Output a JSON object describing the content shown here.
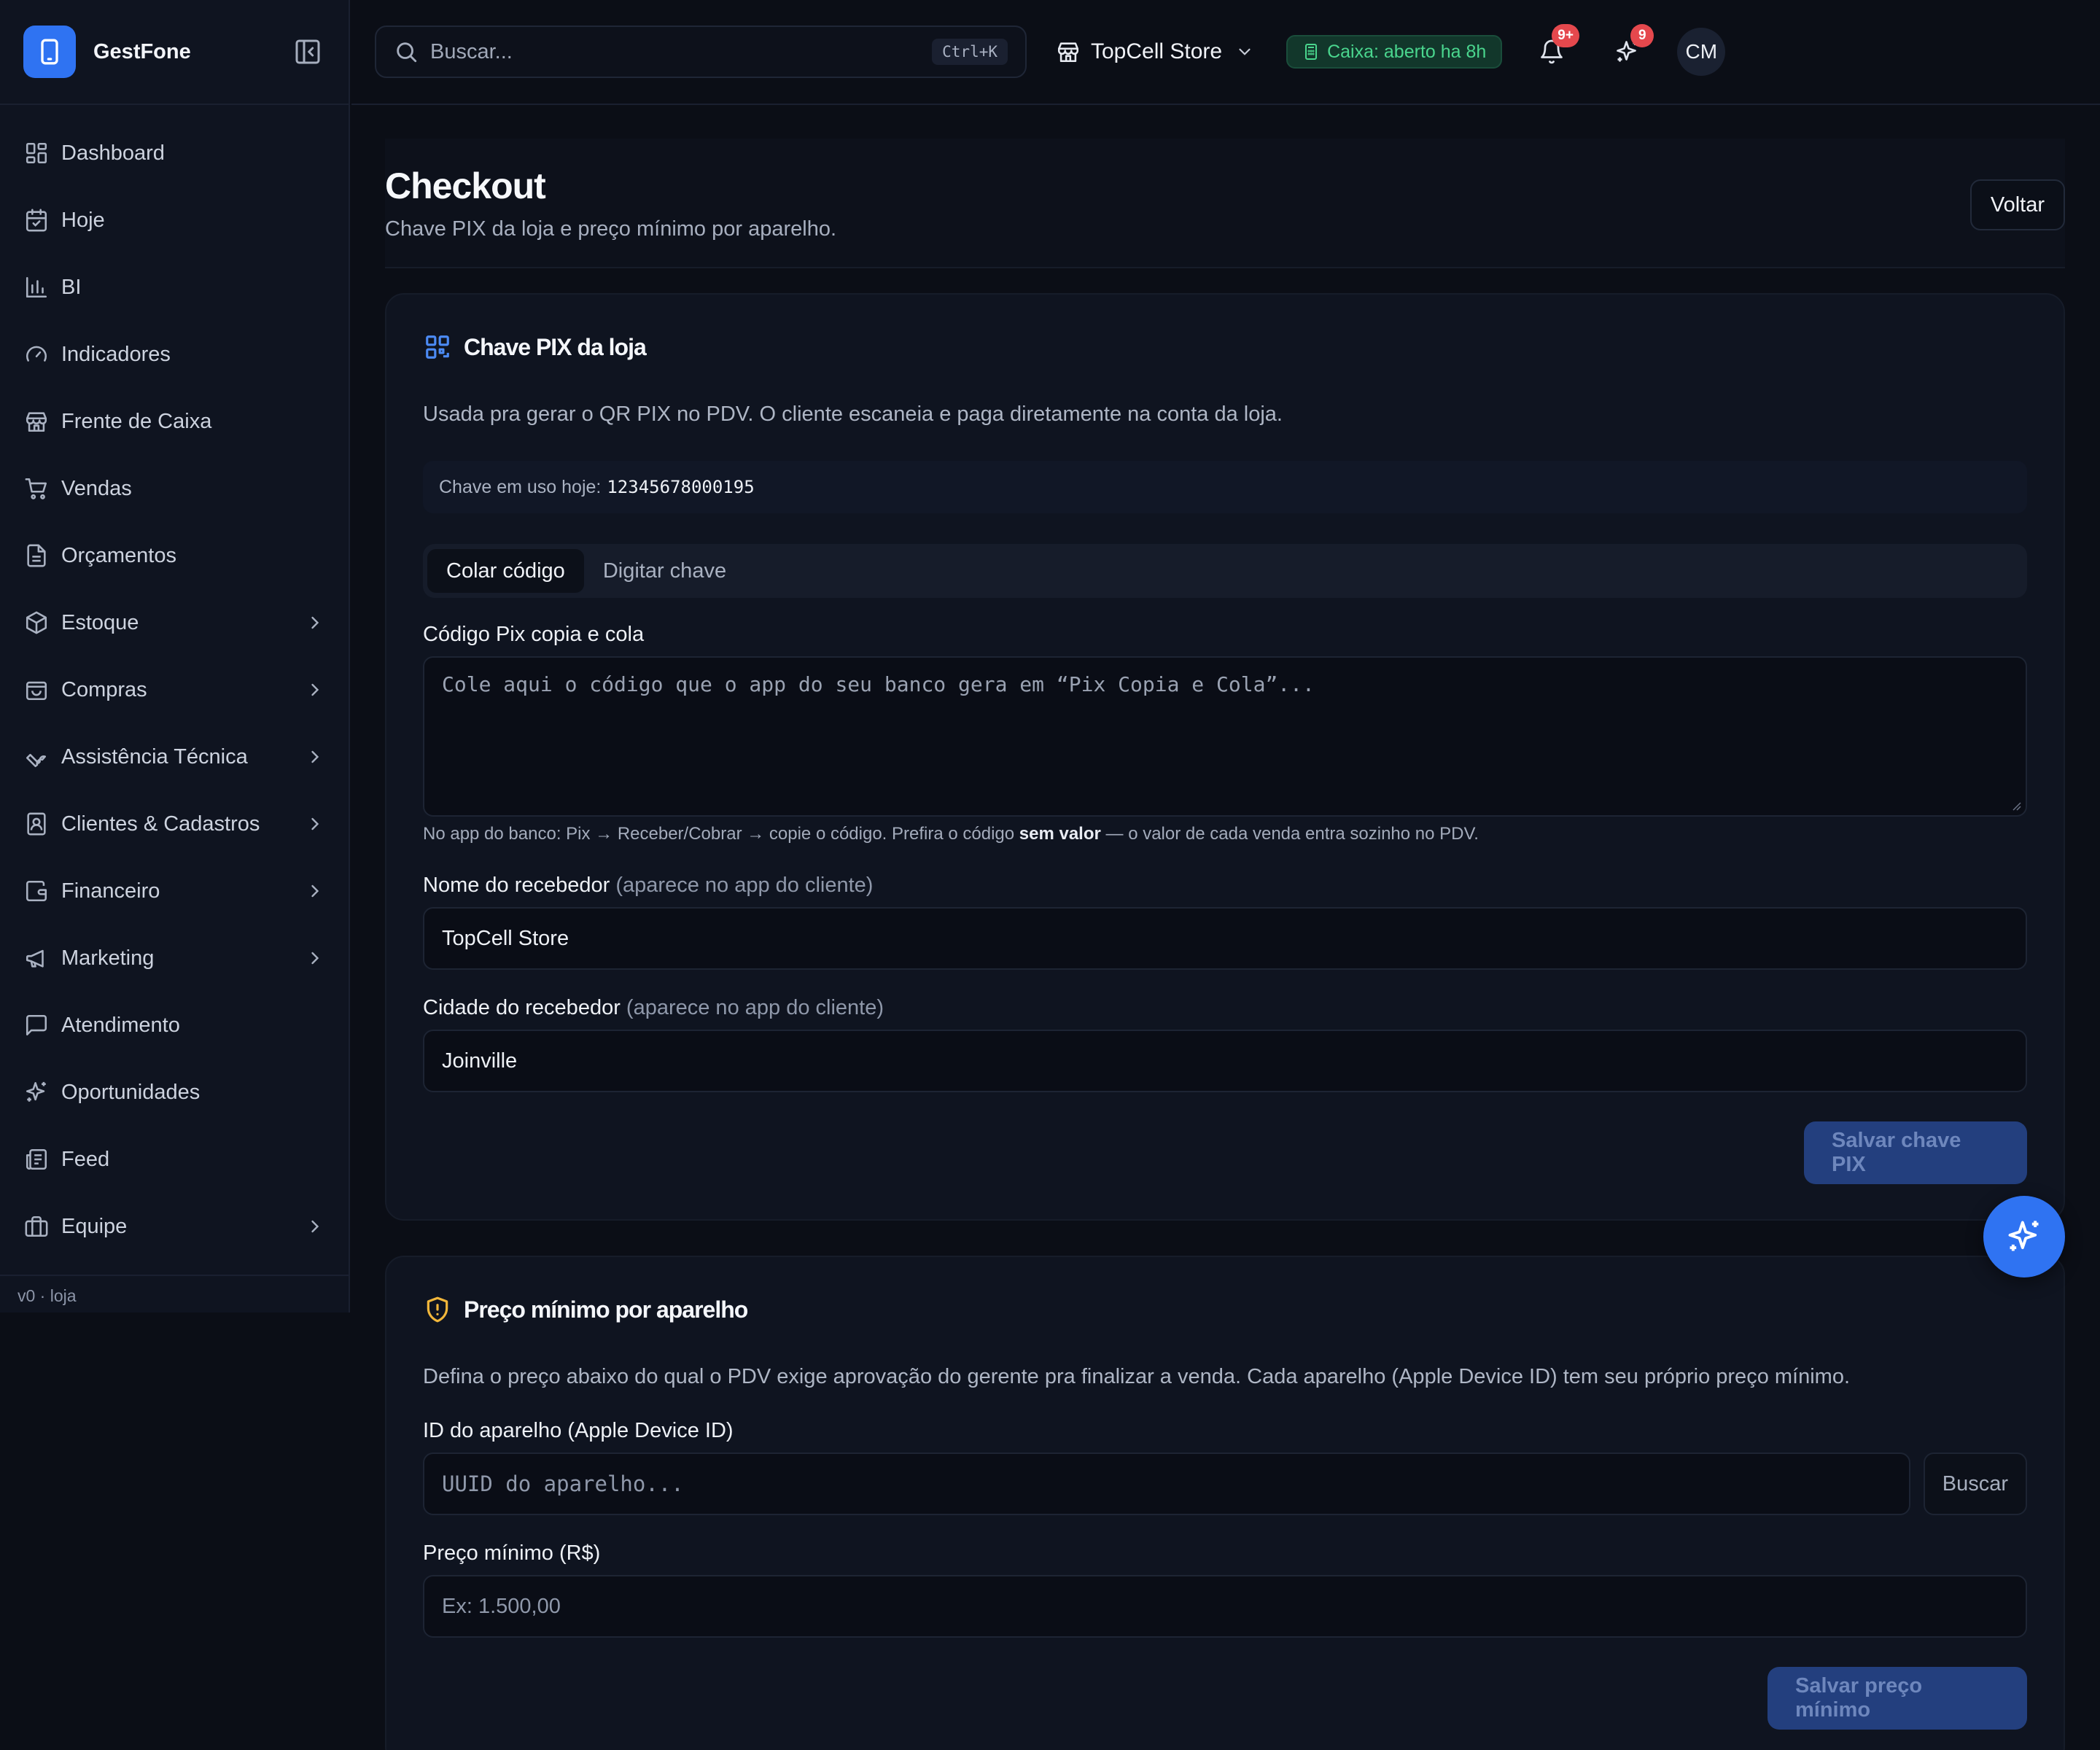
{
  "app": {
    "name": "GestFone",
    "version": "v0 · loja"
  },
  "sidebar": {
    "items": [
      {
        "label": "Dashboard",
        "icon": "dashboard-icon",
        "chevron": false
      },
      {
        "label": "Hoje",
        "icon": "calendar-icon",
        "chevron": false
      },
      {
        "label": "BI",
        "icon": "bar-chart-icon",
        "chevron": false
      },
      {
        "label": "Indicadores",
        "icon": "gauge-icon",
        "chevron": false
      },
      {
        "label": "Frente de Caixa",
        "icon": "store-icon",
        "chevron": false
      },
      {
        "label": "Vendas",
        "icon": "cart-icon",
        "chevron": false
      },
      {
        "label": "Orçamentos",
        "icon": "document-icon",
        "chevron": false
      },
      {
        "label": "Estoque",
        "icon": "package-icon",
        "chevron": true
      },
      {
        "label": "Compras",
        "icon": "shopping-bag-icon",
        "chevron": true
      },
      {
        "label": "Assistência Técnica",
        "icon": "wrench-icon",
        "chevron": true
      },
      {
        "label": "Clientes & Cadastros",
        "icon": "contact-icon",
        "chevron": true
      },
      {
        "label": "Financeiro",
        "icon": "wallet-icon",
        "chevron": true
      },
      {
        "label": "Marketing",
        "icon": "megaphone-icon",
        "chevron": true
      },
      {
        "label": "Atendimento",
        "icon": "chat-icon",
        "chevron": false
      },
      {
        "label": "Oportunidades",
        "icon": "sparkles-icon",
        "chevron": false
      },
      {
        "label": "Feed",
        "icon": "newspaper-icon",
        "chevron": false
      },
      {
        "label": "Equipe",
        "icon": "briefcase-icon",
        "chevron": true
      }
    ]
  },
  "topbar": {
    "search_placeholder": "Buscar...",
    "search_shortcut": "Ctrl+K",
    "store": "TopCell Store",
    "caixa_status": "Caixa: aberto ha 8h",
    "notifications_badge": "9+",
    "ai_badge": "9",
    "avatar_initials": "CM"
  },
  "page": {
    "title": "Checkout",
    "subtitle": "Chave PIX da loja e preço mínimo por aparelho.",
    "back_label": "Voltar"
  },
  "pix": {
    "title": "Chave PIX da loja",
    "description": "Usada pra gerar o QR PIX no PDV. O cliente escaneia e paga diretamente na conta da loja.",
    "current_key_label": "Chave em uso hoje:",
    "current_key_value": "12345678000195",
    "tabs": [
      "Colar código",
      "Digitar chave"
    ],
    "code_label": "Código Pix copia e cola",
    "code_placeholder": "Cole aqui o código que o app do seu banco gera em “Pix Copia e Cola”...",
    "hint_prefix": "No app do banco: Pix → Receber/Cobrar → copie o código. Prefira o código ",
    "hint_bold": "sem valor",
    "hint_suffix": " — o valor de cada venda entra sozinho no PDV.",
    "receiver_name_label": "Nome do recebedor",
    "receiver_name_hint": "(aparece no app do cliente)",
    "receiver_name_value": "TopCell Store",
    "receiver_city_label": "Cidade do recebedor",
    "receiver_city_hint": "(aparece no app do cliente)",
    "receiver_city_value": "Joinville",
    "save_label": "Salvar chave PIX"
  },
  "min_price": {
    "title": "Preço mínimo por aparelho",
    "description": "Defina o preço abaixo do qual o PDV exige aprovação do gerente pra finalizar a venda. Cada aparelho (Apple Device ID) tem seu próprio preço mínimo.",
    "device_label": "ID do aparelho (Apple Device ID)",
    "device_placeholder": "UUID do aparelho...",
    "search_label": "Buscar",
    "price_label": "Preço mínimo (R$)",
    "price_placeholder": "Ex: 1.500,00",
    "save_label": "Salvar preço mínimo"
  },
  "colors": {
    "accent": "#2f73f2",
    "success": "#4ad68e",
    "badge": "#e5484d",
    "warning": "#f2b73b"
  }
}
